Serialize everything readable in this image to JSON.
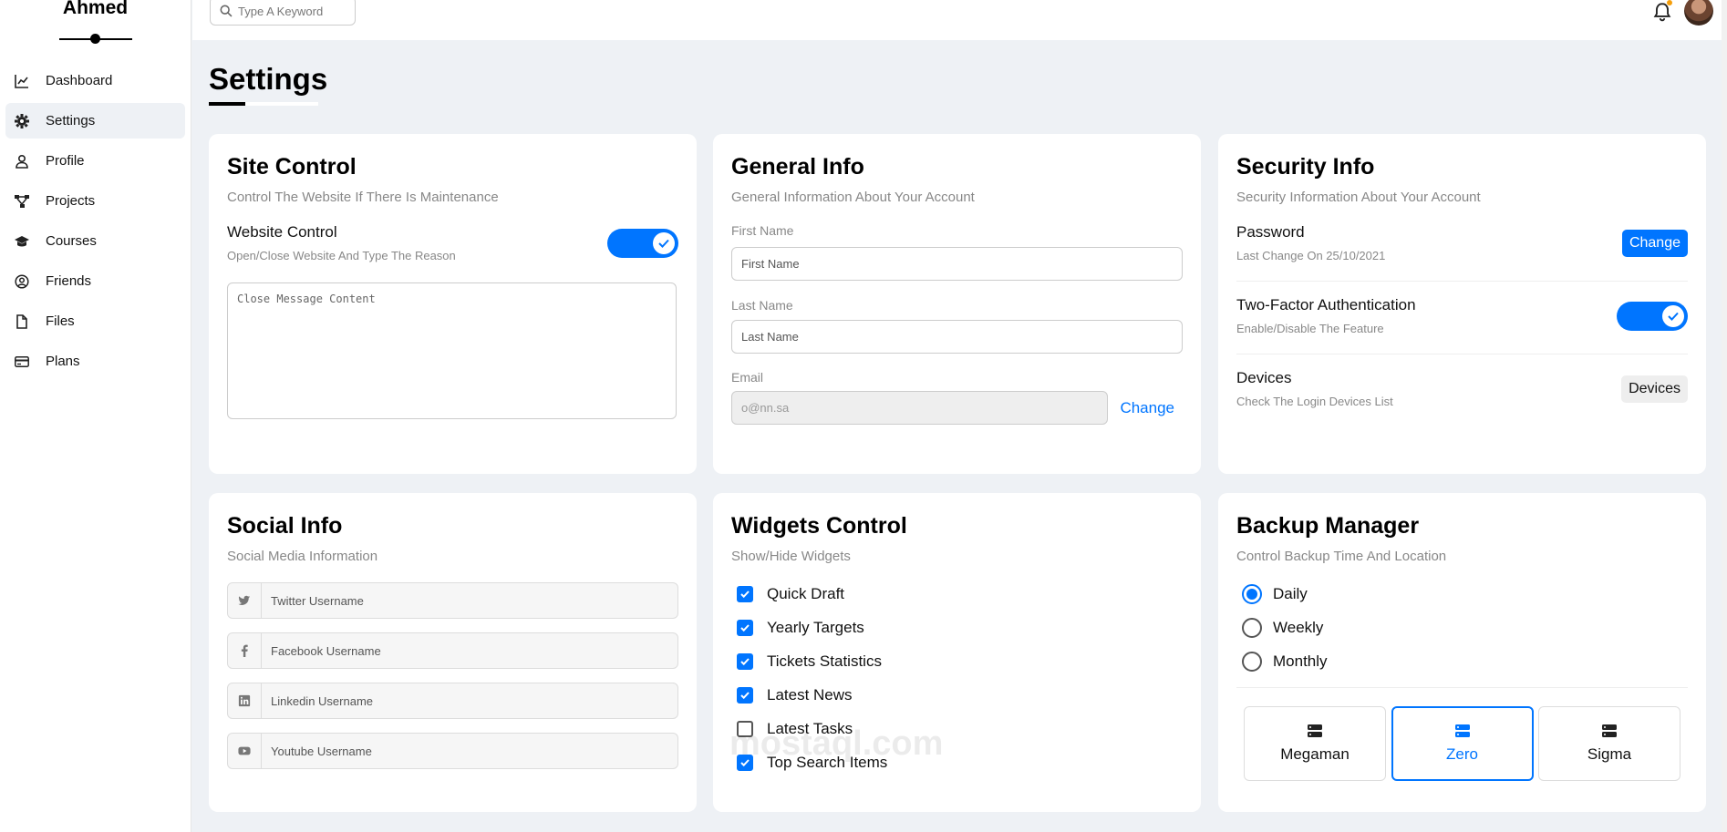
{
  "brand": {
    "name": "Ahmed"
  },
  "sidebar": {
    "items": [
      {
        "label": "Dashboard",
        "icon": "chart-icon"
      },
      {
        "label": "Settings",
        "icon": "gear-icon"
      },
      {
        "label": "Profile",
        "icon": "user-icon"
      },
      {
        "label": "Projects",
        "icon": "diagram-icon"
      },
      {
        "label": "Courses",
        "icon": "graduation-cap-icon"
      },
      {
        "label": "Friends",
        "icon": "user-circle-icon"
      },
      {
        "label": "Files",
        "icon": "file-icon"
      },
      {
        "label": "Plans",
        "icon": "credit-card-icon"
      }
    ],
    "active": "Settings"
  },
  "header": {
    "search_placeholder": "Type A Keyword"
  },
  "page": {
    "title": "Settings"
  },
  "site_control": {
    "title": "Site Control",
    "subtitle": "Control The Website If There Is Maintenance",
    "row_title": "Website Control",
    "row_desc": "Open/Close Website And Type The Reason",
    "toggle_on": true,
    "message_placeholder": "Close Message Content"
  },
  "general_info": {
    "title": "General Info",
    "subtitle": "General Information About Your Account",
    "first_name_label": "First Name",
    "first_name_placeholder": "First Name",
    "last_name_label": "Last Name",
    "last_name_placeholder": "Last Name",
    "email_label": "Email",
    "email_placeholder": "o@nn.sa",
    "change_label": "Change"
  },
  "security_info": {
    "title": "Security Info",
    "subtitle": "Security Information About Your Account",
    "password_title": "Password",
    "password_desc": "Last Change On 25/10/2021",
    "password_button": "Change",
    "twofa_title": "Two-Factor Authentication",
    "twofa_desc": "Enable/Disable The Feature",
    "twofa_on": true,
    "devices_title": "Devices",
    "devices_desc": "Check The Login Devices List",
    "devices_button": "Devices"
  },
  "social_info": {
    "title": "Social Info",
    "subtitle": "Social Media Information",
    "fields": [
      {
        "icon": "twitter-icon",
        "placeholder": "Twitter Username"
      },
      {
        "icon": "facebook-icon",
        "placeholder": "Facebook Username"
      },
      {
        "icon": "linkedin-icon",
        "placeholder": "Linkedin Username"
      },
      {
        "icon": "youtube-icon",
        "placeholder": "Youtube Username"
      }
    ]
  },
  "widgets_control": {
    "title": "Widgets Control",
    "subtitle": "Show/Hide Widgets",
    "items": [
      {
        "label": "Quick Draft",
        "checked": true
      },
      {
        "label": "Yearly Targets",
        "checked": true
      },
      {
        "label": "Tickets Statistics",
        "checked": true
      },
      {
        "label": "Latest News",
        "checked": true
      },
      {
        "label": "Latest Tasks",
        "checked": false
      },
      {
        "label": "Top Search Items",
        "checked": true
      }
    ]
  },
  "backup_manager": {
    "title": "Backup Manager",
    "subtitle": "Control Backup Time And Location",
    "options": [
      {
        "label": "Daily",
        "selected": true
      },
      {
        "label": "Weekly",
        "selected": false
      },
      {
        "label": "Monthly",
        "selected": false
      }
    ],
    "servers": [
      {
        "label": "Megaman",
        "active": false
      },
      {
        "label": "Zero",
        "active": true
      },
      {
        "label": "Sigma",
        "active": false
      }
    ]
  },
  "watermark": "mostaql.com",
  "colors": {
    "accent": "#0075ff",
    "background": "#eef1f5"
  }
}
